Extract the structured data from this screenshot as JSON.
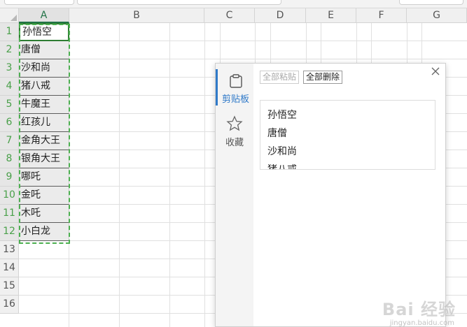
{
  "sheet": {
    "columns": [
      "A",
      "B",
      "C",
      "D",
      "E",
      "F",
      "G"
    ],
    "active_column": "A",
    "rows": [
      "1",
      "2",
      "3",
      "4",
      "5",
      "6",
      "7",
      "8",
      "9",
      "10",
      "11",
      "12",
      "13",
      "14",
      "15",
      "16"
    ],
    "column_a_values": [
      "孙悟空",
      "唐僧",
      "沙和尚",
      "猪八戒",
      "牛魔王",
      "红孩儿",
      "金角大王",
      "银角大王",
      "哪吒",
      "金吒",
      "木吒",
      "小白龙"
    ]
  },
  "clipboard_panel": {
    "sidebar": {
      "clipboard_label": "剪贴板",
      "favorites_label": "收藏"
    },
    "paste_all_label": "全部粘贴",
    "delete_all_label": "全部删除",
    "items": [
      "孙悟空",
      "唐僧",
      "沙和尚",
      "猪八戒"
    ]
  },
  "watermark": {
    "text": "Bai 经验",
    "url": "jingyan.baidu.com"
  },
  "colors": {
    "accent_green": "#4caf50",
    "accent_blue": "#2f79c8"
  }
}
